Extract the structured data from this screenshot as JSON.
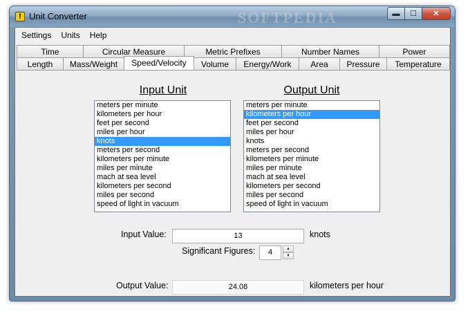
{
  "window": {
    "title": "Unit Converter",
    "watermark": "SOFTPEDIA",
    "buttons": {
      "minimize": "▬",
      "maximize": "☐",
      "close": "✕"
    }
  },
  "menu": [
    "Settings",
    "Units",
    "Help"
  ],
  "tabs": {
    "row1": [
      "Time",
      "Circular Measure",
      "Metric Prefixes",
      "Number Names",
      "Power"
    ],
    "row2": [
      "Length",
      "Mass/Weight",
      "Speed/Velocity",
      "Volume",
      "Energy/Work",
      "Area",
      "Pressure",
      "Temperature"
    ],
    "active": "Speed/Velocity"
  },
  "input_unit": {
    "header": "Input Unit",
    "items": [
      "meters per minute",
      "kilometers per hour",
      "feet per second",
      "miles per hour",
      "knots",
      "meters per second",
      "kilometers per minute",
      "miles per minute",
      "mach at sea level",
      "kilometers per second",
      "miles per second",
      "speed of light in vacuum"
    ],
    "selected": "knots"
  },
  "output_unit": {
    "header": "Output Unit",
    "items": [
      "meters per minute",
      "kilometers per hour",
      "feet per second",
      "miles per hour",
      "knots",
      "meters per second",
      "kilometers per minute",
      "miles per minute",
      "mach at sea level",
      "kilometers per second",
      "miles per second",
      "speed of light in vacuum"
    ],
    "selected": "kilometers per hour"
  },
  "form": {
    "input_label": "Input Value:",
    "input_value": "13",
    "input_unit_text": "knots",
    "sig_label": "Significant Figures:",
    "sig_value": "4",
    "output_label": "Output Value:",
    "output_value": "24.08",
    "output_unit_text": "kilometers per hour"
  }
}
